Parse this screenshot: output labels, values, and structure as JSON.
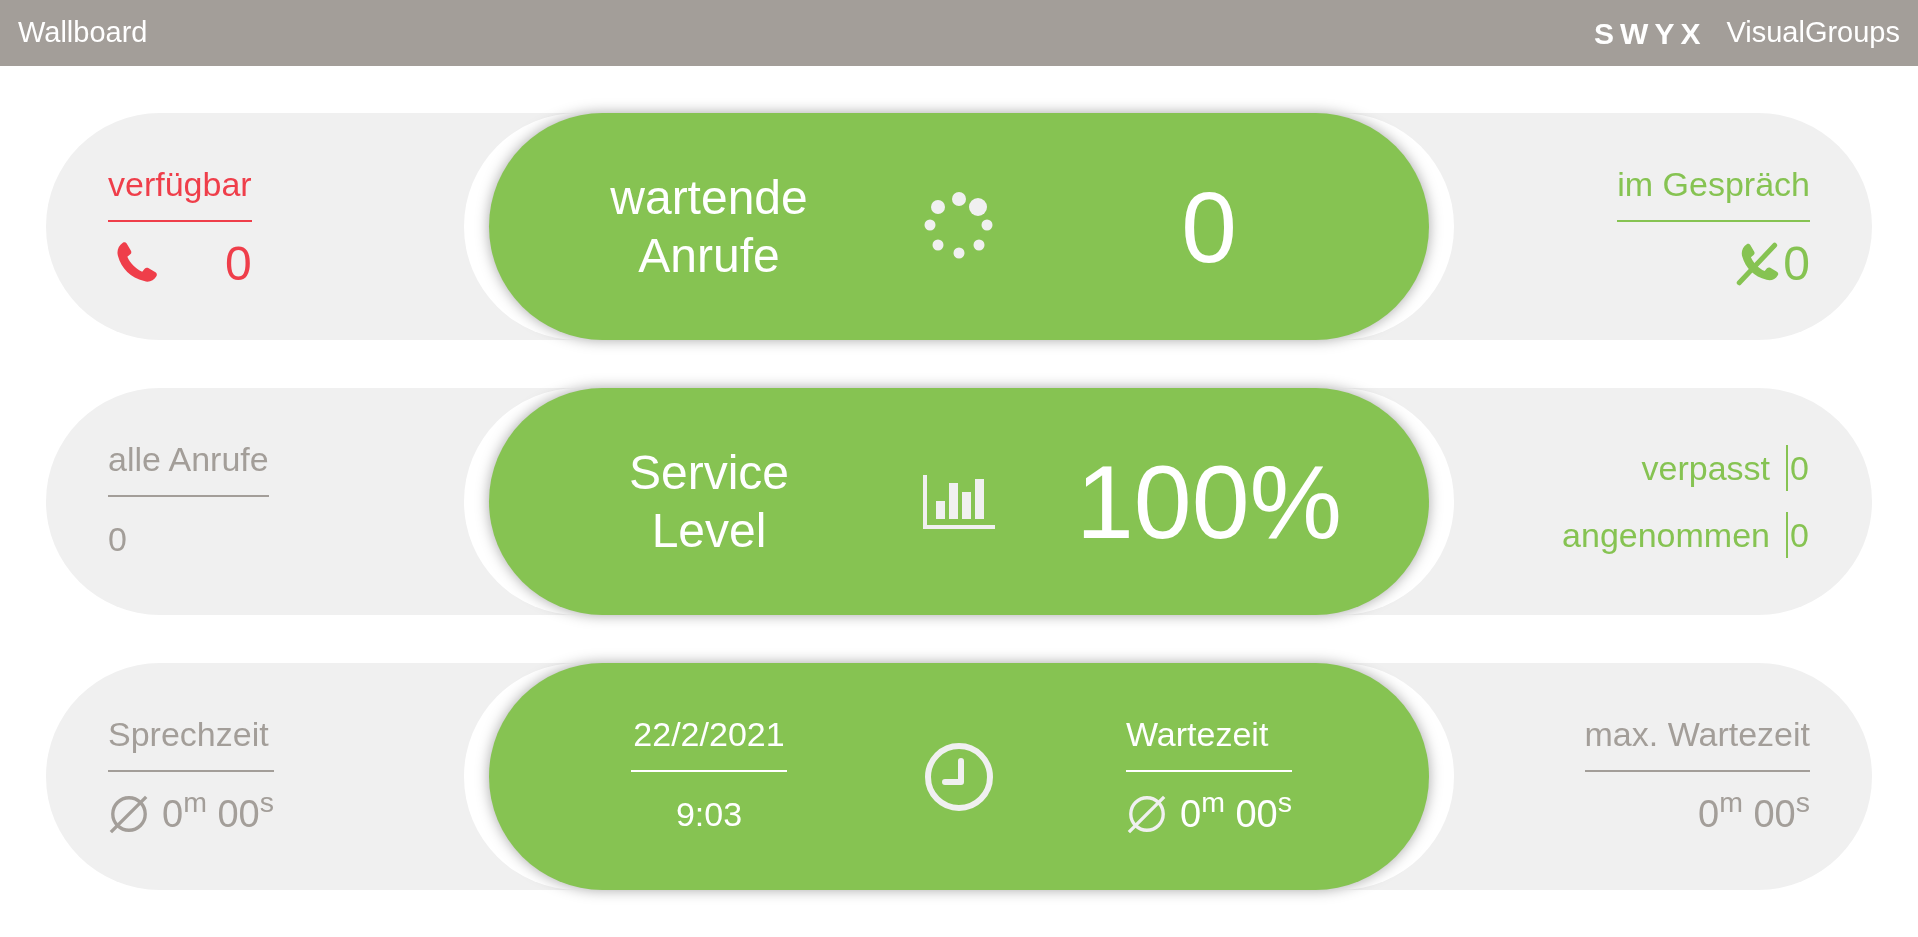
{
  "header": {
    "title": "Wallboard",
    "logo": "SWYX",
    "brand": "VisualGroups"
  },
  "available": {
    "label": "verfügbar",
    "value": "0"
  },
  "waiting_calls": {
    "label_lines": [
      "wartende",
      "Anrufe"
    ],
    "value": "0"
  },
  "in_call": {
    "label": "im Gespräch",
    "value": "0"
  },
  "all_calls": {
    "label": "alle Anrufe",
    "value": "0"
  },
  "service_level": {
    "label_lines": [
      "Service",
      "Level"
    ],
    "value": "100%"
  },
  "service_stats": [
    {
      "label": "verpasst",
      "value": "0"
    },
    {
      "label": "angenommen",
      "value": "0"
    }
  ],
  "talk_time": {
    "label": "Sprechzeit",
    "value": "0$^{m}$ 00$^{s}$"
  },
  "date_time": {
    "date": "22/2/2021",
    "time": "9:03"
  },
  "wait_time": {
    "label": "Wartezeit",
    "value": "0$^{m}$ 00$^{s}$"
  },
  "max_wait_time": {
    "label": "max. Wartezeit",
    "value": "0$^{m}$ 00$^{s}$"
  }
}
